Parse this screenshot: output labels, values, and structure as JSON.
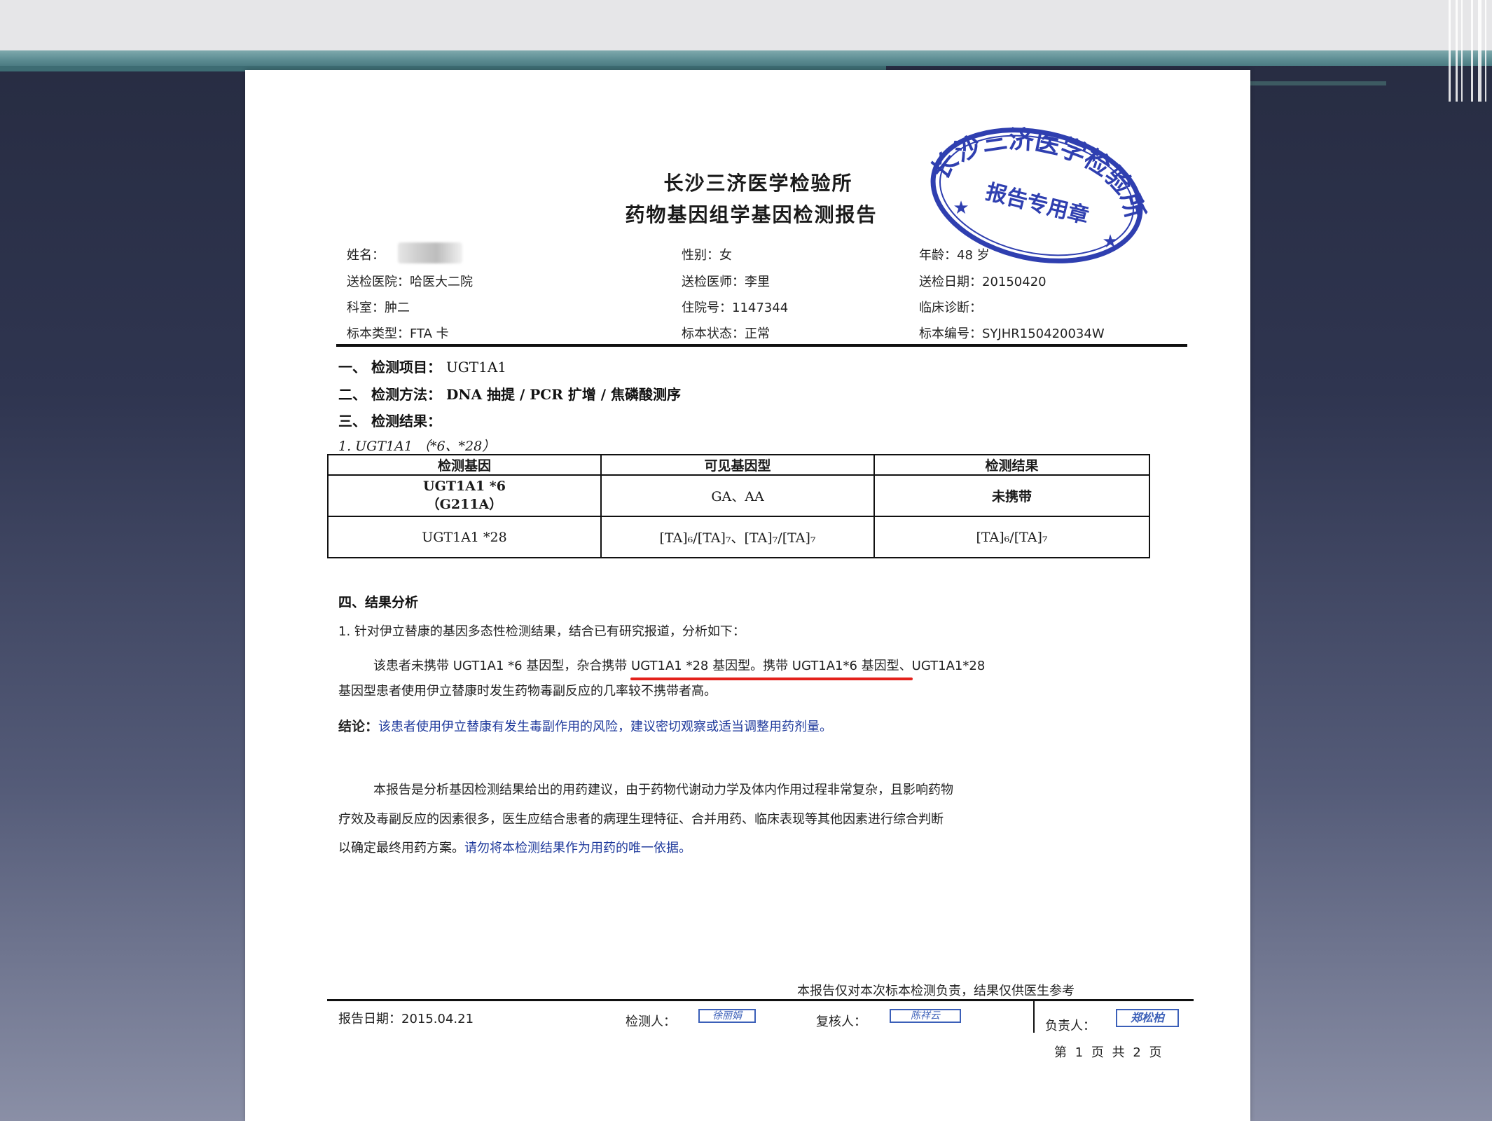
{
  "header": {
    "institute": "长沙三济医学检验所",
    "report_title": "药物基因组学基因检测报告"
  },
  "stamp": {
    "arc_text": "长沙三济医学检验所",
    "center_text": "报告专用章"
  },
  "patient": {
    "name_label": "姓名：",
    "gender": "性别：女",
    "age": "年龄：48 岁",
    "hospital": "送检医院：哈医大二院",
    "doctor": "送检医师：李里",
    "send_date": "送检日期：20150420",
    "department": "科室：肿二",
    "inpatient_no": "住院号：1147344",
    "diagnosis": "临床诊断：",
    "sample_type": "标本类型：FTA 卡",
    "sample_status": "标本状态：正常",
    "sample_no": "标本编号：SYJHR150420034W"
  },
  "sections": {
    "s1_label": "一、 检测项目：",
    "s1_value": "UGT1A1",
    "s2_label": "二、 检测方法：",
    "s2_value": "DNA 抽提 / PCR 扩增 / 焦磷酸测序",
    "s3_label": "三、 检测结果：",
    "sub_label": "1. UGT1A1 （*6、*28）"
  },
  "table": {
    "headers": [
      "检测基因",
      "可见基因型",
      "检测结果"
    ],
    "rows": [
      {
        "gene_line1": "UGT1A1 *6",
        "gene_line2": "（G211A）",
        "genotypes": "GA、AA",
        "result": "未携带"
      },
      {
        "gene_line1": "UGT1A1 *28",
        "gene_line2": "",
        "genotypes": "[TA]₆/[TA]₇、[TA]₇/[TA]₇",
        "result": "[TA]₆/[TA]₇"
      }
    ]
  },
  "analysis": {
    "heading": "四、结果分析",
    "line1": "1. 针对伊立替康的基因多态性检测结果，结合已有研究报道，分析如下：",
    "p1_a": "该患者未携带 UGT1A1 *6 基因型，",
    "p1_b": "杂合携带 UGT1A1 *28 基因型。",
    "p1_c": "携带 UGT1A1*6 基因型、UGT1A1*28",
    "p1_d": "基因型患者使用伊立替康时发生药物毒副反应的几率较不携带者高。",
    "conclusion_label": "结论：",
    "conclusion_text": "该患者使用伊立替康有发生毒副作用的风险，建议密切观察或适当调整用药剂量。"
  },
  "disclaimer": {
    "line1": "本报告是分析基因检测结果给出的用药建议，由于药物代谢动力学及体内作用过程非常复杂，且影响药物",
    "line2": "疗效及毒副反应的因素很多，医生应结合患者的病理生理特征、合并用药、临床表现等其他因素进行综合判断",
    "line3_a": "以确定最终用药方案。",
    "line3_b": "请勿将本检测结果作为用药的唯一依据。"
  },
  "footer": {
    "note": "本报告仅对本次标本检测负责，结果仅供医生参考",
    "report_date": "报告日期：2015.04.21",
    "tester_label": "检测人：",
    "tester_sig": "徐丽娟",
    "reviewer_label": "复核人：",
    "reviewer_sig": "陈祥云",
    "manager_label": "负责人：",
    "manager_sig": "郑松柏",
    "page": "第 1 页 共 2 页"
  },
  "colors": {
    "stamp_blue": "#2f3fb0",
    "underline_red": "#e3211b",
    "text_blue": "#1f3a9c"
  }
}
